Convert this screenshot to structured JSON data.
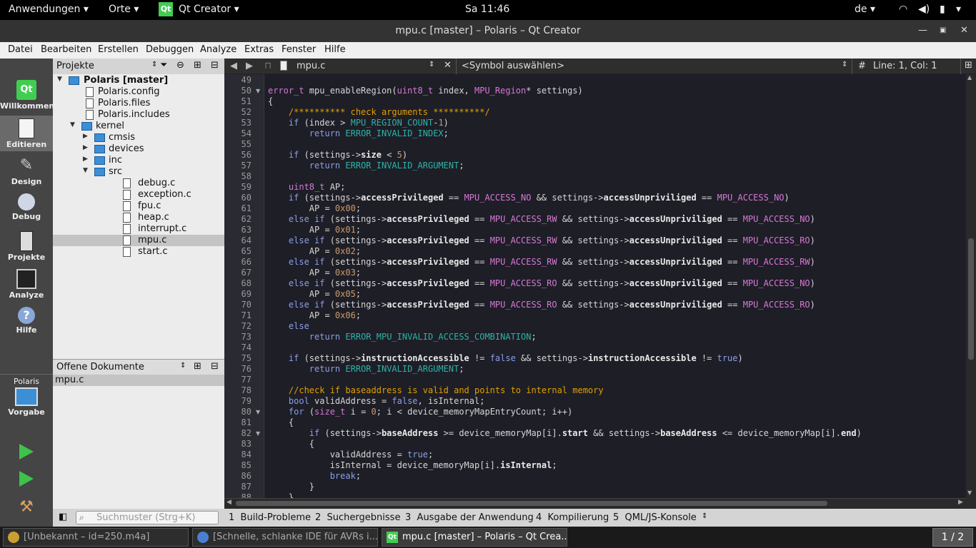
{
  "topbar": {
    "apps": "Anwendungen",
    "places": "Orte",
    "app_name": "Qt Creator",
    "clock": "Sa 11:46",
    "lang": "de"
  },
  "window": {
    "title": "mpu.c [master] – Polaris – Qt Creator"
  },
  "menu": [
    "Datei",
    "Bearbeiten",
    "Erstellen",
    "Debuggen",
    "Analyze",
    "Extras",
    "Fenster",
    "Hilfe"
  ],
  "modes": {
    "welcome": "Willkommen",
    "edit": "Editieren",
    "design": "Design",
    "debug": "Debug",
    "projects": "Projekte",
    "analyze": "Analyze",
    "help": "Hilfe",
    "target_project": "Polaris",
    "target_kit": "Vorgabe"
  },
  "nav": {
    "header": "Projekte",
    "tree": [
      {
        "label": "Polaris [master]",
        "kind": "project",
        "depth": 0,
        "open": true
      },
      {
        "label": "Polaris.config",
        "kind": "file",
        "depth": 1
      },
      {
        "label": "Polaris.files",
        "kind": "file",
        "depth": 1
      },
      {
        "label": "Polaris.includes",
        "kind": "file",
        "depth": 1
      },
      {
        "label": "kernel",
        "kind": "dir",
        "depth": 1,
        "open": true
      },
      {
        "label": "cmsis",
        "kind": "dir",
        "depth": 2,
        "open": false
      },
      {
        "label": "devices",
        "kind": "dir",
        "depth": 2,
        "open": false
      },
      {
        "label": "inc",
        "kind": "dir",
        "depth": 2,
        "open": false
      },
      {
        "label": "src",
        "kind": "dir",
        "depth": 2,
        "open": true
      },
      {
        "label": "debug.c",
        "kind": "file",
        "depth": 3
      },
      {
        "label": "exception.c",
        "kind": "file",
        "depth": 3
      },
      {
        "label": "fpu.c",
        "kind": "file",
        "depth": 3
      },
      {
        "label": "heap.c",
        "kind": "file",
        "depth": 3
      },
      {
        "label": "interrupt.c",
        "kind": "file",
        "depth": 3
      },
      {
        "label": "mpu.c",
        "kind": "file",
        "depth": 3,
        "selected": true
      },
      {
        "label": "start.c",
        "kind": "file",
        "depth": 3
      }
    ]
  },
  "open_docs": {
    "header": "Offene Dokumente",
    "items": [
      "mpu.c"
    ]
  },
  "editor_toolbar": {
    "file": "mpu.c",
    "symbol": "<Symbol auswählen>",
    "hash": "#",
    "position": "Line: 1, Col: 1"
  },
  "code": [
    {
      "n": "49",
      "t": ""
    },
    {
      "n": "50",
      "t": "<span class='ty'>error_t</span> mpu_enableRegion(<span class='ty'>uint8_t</span> index, <span class='ty'>MPU_Region</span>* settings)",
      "fold": true
    },
    {
      "n": "51",
      "t": "{"
    },
    {
      "n": "52",
      "t": "    <span class='cm'>/********** check arguments **********/</span>"
    },
    {
      "n": "53",
      "t": "    <span class='kw'>if</span> (index &gt; <span class='mc'>MPU_REGION_COUNT</span>-<span class='nm'>1</span>)"
    },
    {
      "n": "54",
      "t": "        <span class='kw'>return</span> <span class='mc'>ERROR_INVALID_INDEX</span>;"
    },
    {
      "n": "55",
      "t": ""
    },
    {
      "n": "56",
      "t": "    <span class='kw'>if</span> (settings-&gt;<span class='mm'>size</span> &lt; <span class='nm'>5</span>)"
    },
    {
      "n": "57",
      "t": "        <span class='kw'>return</span> <span class='mc'>ERROR_INVALID_ARGUMENT</span>;"
    },
    {
      "n": "58",
      "t": ""
    },
    {
      "n": "59",
      "t": "    <span class='ty'>uint8_t</span> AP;"
    },
    {
      "n": "60",
      "t": "    <span class='kw'>if</span> (settings-&gt;<span class='mm'>accessPrivileged</span> == <span class='ty'>MPU_ACCESS_NO</span> &amp;&amp; settings-&gt;<span class='mm'>accessUnpriviliged</span> == <span class='ty'>MPU_ACCESS_NO</span>)"
    },
    {
      "n": "61",
      "t": "        AP = <span class='nm'>0x00</span>;"
    },
    {
      "n": "62",
      "t": "    <span class='kw'>else if</span> (settings-&gt;<span class='mm'>accessPrivileged</span> == <span class='ty'>MPU_ACCESS_RW</span> &amp;&amp; settings-&gt;<span class='mm'>accessUnpriviliged</span> == <span class='ty'>MPU_ACCESS_NO</span>)"
    },
    {
      "n": "63",
      "t": "        AP = <span class='nm'>0x01</span>;"
    },
    {
      "n": "64",
      "t": "    <span class='kw'>else if</span> (settings-&gt;<span class='mm'>accessPrivileged</span> == <span class='ty'>MPU_ACCESS_RW</span> &amp;&amp; settings-&gt;<span class='mm'>accessUnpriviliged</span> == <span class='ty'>MPU_ACCESS_RO</span>)"
    },
    {
      "n": "65",
      "t": "        AP = <span class='nm'>0x02</span>;"
    },
    {
      "n": "66",
      "t": "    <span class='kw'>else if</span> (settings-&gt;<span class='mm'>accessPrivileged</span> == <span class='ty'>MPU_ACCESS_RW</span> &amp;&amp; settings-&gt;<span class='mm'>accessUnpriviliged</span> == <span class='ty'>MPU_ACCESS_RW</span>)"
    },
    {
      "n": "67",
      "t": "        AP = <span class='nm'>0x03</span>;"
    },
    {
      "n": "68",
      "t": "    <span class='kw'>else if</span> (settings-&gt;<span class='mm'>accessPrivileged</span> == <span class='ty'>MPU_ACCESS_RO</span> &amp;&amp; settings-&gt;<span class='mm'>accessUnpriviliged</span> == <span class='ty'>MPU_ACCESS_NO</span>)"
    },
    {
      "n": "69",
      "t": "        AP = <span class='nm'>0x05</span>;"
    },
    {
      "n": "70",
      "t": "    <span class='kw'>else if</span> (settings-&gt;<span class='mm'>accessPrivileged</span> == <span class='ty'>MPU_ACCESS_RO</span> &amp;&amp; settings-&gt;<span class='mm'>accessUnpriviliged</span> == <span class='ty'>MPU_ACCESS_RO</span>)"
    },
    {
      "n": "71",
      "t": "        AP = <span class='nm'>0x06</span>;"
    },
    {
      "n": "72",
      "t": "    <span class='kw'>else</span>"
    },
    {
      "n": "73",
      "t": "        <span class='kw'>return</span> <span class='mc'>ERROR_MPU_INVALID_ACCESS_COMBINATION</span>;"
    },
    {
      "n": "74",
      "t": ""
    },
    {
      "n": "75",
      "t": "    <span class='kw'>if</span> (settings-&gt;<span class='mm'>instructionAccessible</span> != <span class='bl'>false</span> &amp;&amp; settings-&gt;<span class='mm'>instructionAccessible</span> != <span class='bl'>true</span>)"
    },
    {
      "n": "76",
      "t": "        <span class='kw'>return</span> <span class='mc'>ERROR_INVALID_ARGUMENT</span>;"
    },
    {
      "n": "77",
      "t": ""
    },
    {
      "n": "78",
      "t": "    <span class='cm'>//check if baseaddress is valid and points to internal memory</span>"
    },
    {
      "n": "79",
      "t": "    <span class='kw'>bool</span> validAddress = <span class='bl'>false</span>, isInternal;"
    },
    {
      "n": "80",
      "t": "    <span class='kw'>for</span> (<span class='ty'>size_t</span> i = <span class='nm'>0</span>; i &lt; device_memoryMapEntryCount; i++)",
      "fold": true
    },
    {
      "n": "81",
      "t": "    {"
    },
    {
      "n": "82",
      "t": "        <span class='kw'>if</span> (settings-&gt;<span class='mm'>baseAddress</span> &gt;= device_memoryMap[i].<span class='mm'>start</span> &amp;&amp; settings-&gt;<span class='mm'>baseAddress</span> &lt;= device_memoryMap[i].<span class='mm'>end</span>)",
      "fold": true
    },
    {
      "n": "83",
      "t": "        {"
    },
    {
      "n": "84",
      "t": "            validAddress = <span class='bl'>true</span>;"
    },
    {
      "n": "85",
      "t": "            isInternal = device_memoryMap[i].<span class='mm'>isInternal</span>;"
    },
    {
      "n": "86",
      "t": "            <span class='kw'>break</span>;"
    },
    {
      "n": "87",
      "t": "        }"
    },
    {
      "n": "88",
      "t": "    }"
    }
  ],
  "status": {
    "search_placeholder": "Suchmuster (Strg+K)",
    "panes": [
      {
        "num": "1",
        "label": "Build-Probleme"
      },
      {
        "num": "2",
        "label": "Suchergebnisse"
      },
      {
        "num": "3",
        "label": "Ausgabe der Anwendung"
      },
      {
        "num": "4",
        "label": "Kompilierung"
      },
      {
        "num": "5",
        "label": "QML/JS-Konsole"
      }
    ]
  },
  "taskbar": {
    "tasks": [
      "[Unbekannt – id=250.m4a]",
      "[Schnelle, schlanke IDE für AVRs i...",
      "mpu.c [master] – Polaris – Qt Crea..."
    ],
    "workspace": "1 / 2"
  }
}
